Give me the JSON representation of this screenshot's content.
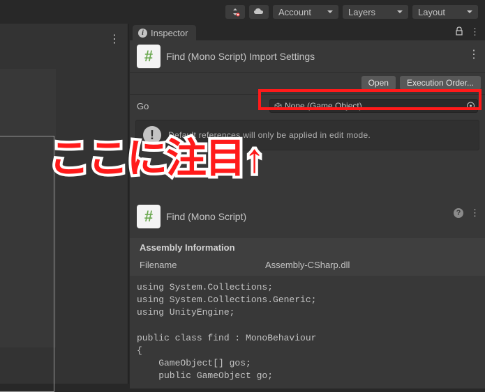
{
  "toolbar": {
    "account": "Account",
    "layers": "Layers",
    "layout": "Layout"
  },
  "inspector": {
    "tab_label": "Inspector",
    "title": "Find (Mono Script) Import Settings",
    "open_btn": "Open",
    "exec_order_btn": "Execution Order...",
    "field": {
      "label": "Go",
      "value": "None (Game Object)"
    },
    "info_message": "Default references will only be applied in edit mode.",
    "second_title": "Find (Mono Script)",
    "assembly": {
      "header": "Assembly Information",
      "filename_label": "Filename",
      "filename_value": "Assembly-CSharp.dll"
    },
    "code": "using System.Collections;\nusing System.Collections.Generic;\nusing UnityEngine;\n\npublic class find : MonoBehaviour\n{\n    GameObject[] gos;\n    public GameObject go;"
  },
  "annotation": "ここに注目↑"
}
